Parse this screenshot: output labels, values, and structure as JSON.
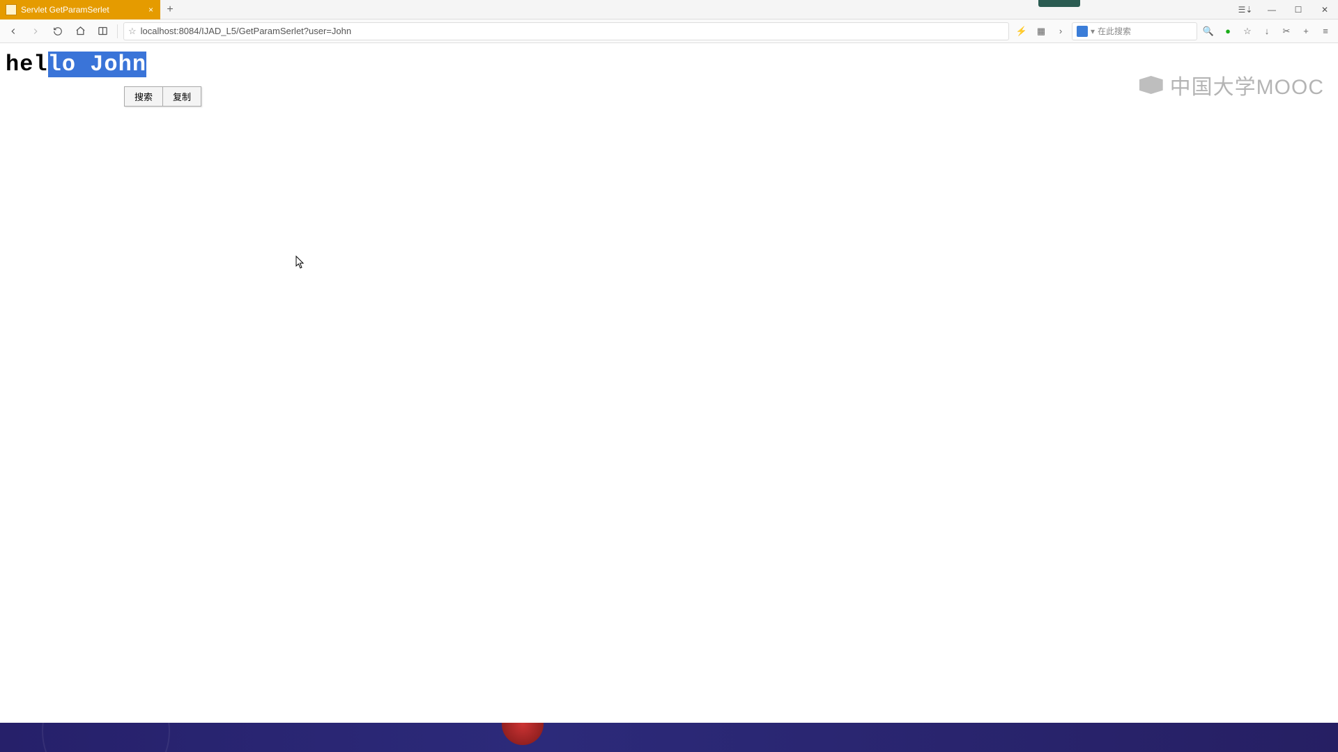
{
  "tab": {
    "title": "Servlet GetParamSerlet"
  },
  "address": {
    "url": "localhost:8084/IJAD_L5/GetParamSerlet?user=John"
  },
  "searchbox": {
    "placeholder": "在此搜索"
  },
  "page": {
    "text_prefix": "hel",
    "text_selected": "lo John"
  },
  "context_menu": {
    "search": "搜索",
    "copy": "复制"
  },
  "watermark": {
    "text": "中国大学MOOC"
  }
}
